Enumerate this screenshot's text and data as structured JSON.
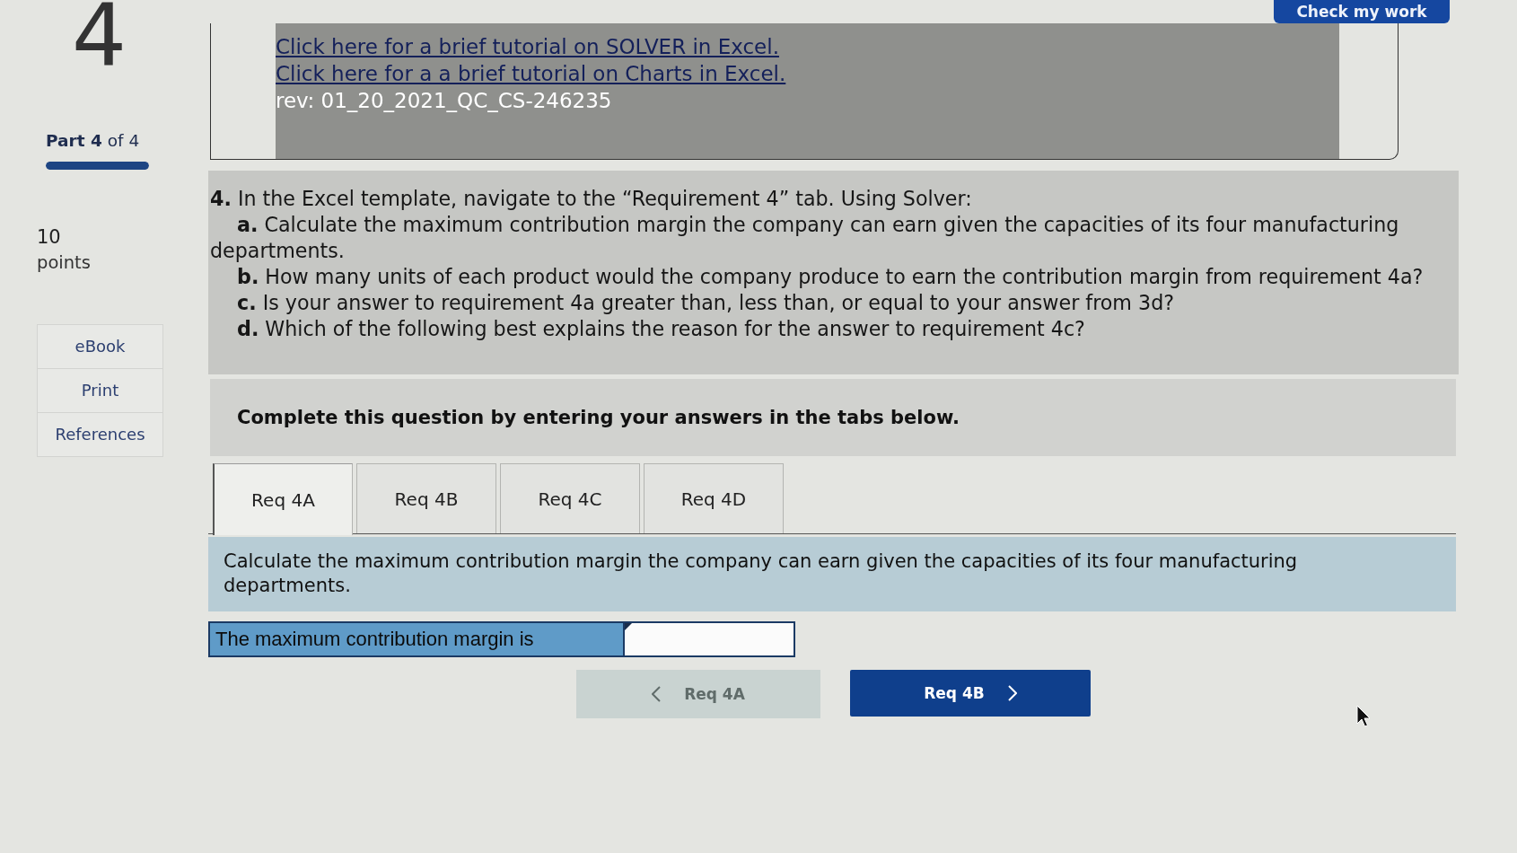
{
  "header": {
    "check_button": "Check my work"
  },
  "sidebar": {
    "question_number": "4",
    "part_label": "**Part 4** of 4",
    "progress": {
      "level": 1
    },
    "points_value": "10",
    "points_label": "points",
    "links": [
      "eBook",
      "Print",
      "References"
    ]
  },
  "resources": {
    "links": [
      "Click here for a brief tutorial on SOLVER in Excel.",
      "Click here for a a brief tutorial on Charts in Excel."
    ],
    "revision": "rev: 01_20_2021_QC_CS-246235"
  },
  "question": {
    "intro": "**4.** In the Excel template, navigate to the “Requirement 4” tab. Using Solver:",
    "parts": [
      "**a.** Calculate the maximum contribution margin the company can earn given the capacities of its four manufacturing departments.",
      "**b.** How many units of each product would the company produce to earn the contribution margin from requirement 4a?",
      "**c.** Is your answer to requirement 4a greater than, less than, or equal to your answer from 3d?",
      "**d.** Which of the following best explains the reason for the answer to requirement 4c?"
    ]
  },
  "instructions": "Complete this question by entering your answers in the tabs below.",
  "tabs": [
    {
      "label": "Req 4A",
      "selected": true
    },
    {
      "label": "Req 4B",
      "selected": false
    },
    {
      "label": "Req 4C",
      "selected": false
    },
    {
      "label": "Req 4D",
      "selected": false
    }
  ],
  "requirement_text": "Calculate the maximum contribution margin the company can earn given the capacities of its four manufacturing departments.",
  "answer": {
    "label": "The maximum contribution margin is"
  },
  "nav_buttons": [
    {
      "kind": "previous",
      "label": "Req 4A",
      "disabled": true
    },
    {
      "kind": "next",
      "label": "Req 4B",
      "disabled": false
    }
  ]
}
